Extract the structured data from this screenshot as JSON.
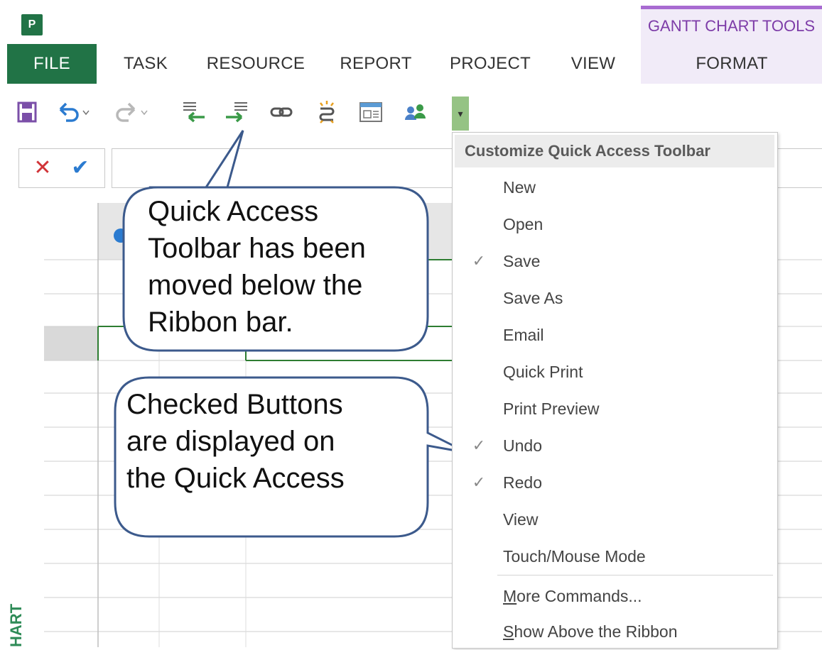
{
  "app": {
    "logo_letter": "P"
  },
  "contextual_tab": {
    "title": "GANTT CHART TOOLS"
  },
  "ribbon": {
    "tabs": [
      "FILE",
      "TASK",
      "RESOURCE",
      "REPORT",
      "PROJECT",
      "VIEW",
      "FORMAT"
    ]
  },
  "qat": {
    "buttons": [
      "save-icon",
      "undo-icon",
      "redo-icon",
      "outdent-icon",
      "indent-icon",
      "link-tasks-icon",
      "unlink-tasks-icon",
      "timeline-icon",
      "team-planner-icon"
    ],
    "dropdown_glyph": "▾"
  },
  "entry_bar": {
    "cancel": "✕",
    "confirm": "✔",
    "value": ""
  },
  "side_label": "HART",
  "callouts": {
    "toolbar_moved": [
      "Quick Access",
      "Toolbar has been",
      "moved below the",
      "Ribbon bar."
    ],
    "checked_buttons": [
      "Checked Buttons",
      "are displayed on",
      "the Quick Access"
    ]
  },
  "menu": {
    "title": "Customize Quick Access Toolbar",
    "items": [
      {
        "label": "New",
        "checked": ""
      },
      {
        "label": "Open",
        "checked": ""
      },
      {
        "label": "Save",
        "checked": "✓"
      },
      {
        "label": "Save As",
        "checked": ""
      },
      {
        "label": "Email",
        "checked": ""
      },
      {
        "label": "Quick Print",
        "checked": ""
      },
      {
        "label": "Print Preview",
        "checked": ""
      },
      {
        "label": "Undo",
        "checked": "✓"
      },
      {
        "label": "Redo",
        "checked": "✓"
      },
      {
        "label": "View",
        "checked": ""
      },
      {
        "label": "Touch/Mouse Mode",
        "checked": ""
      }
    ],
    "more_commands": {
      "accel": "M",
      "rest": "ore Commands..."
    },
    "show_above": {
      "accel": "S",
      "rest": "how Above the Ribbon"
    }
  },
  "colors": {
    "file_tab": "#217346",
    "contextual_accent": "#7d3ca8",
    "callout_border": "#3c5a8c",
    "grid_green": "#2e7d32"
  }
}
